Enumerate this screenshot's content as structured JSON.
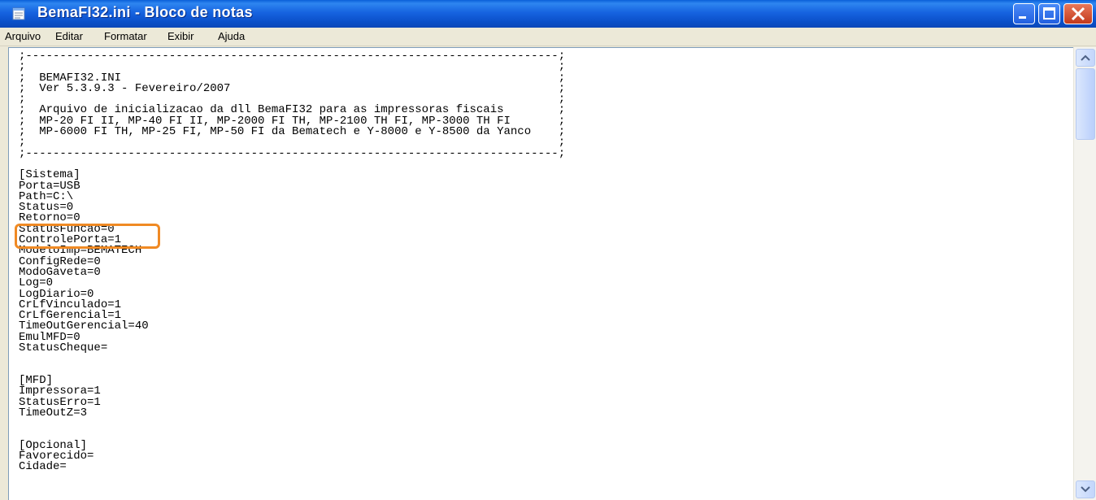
{
  "window": {
    "title": "BemaFI32.ini - Bloco de notas",
    "titlebar_color": "#0a4fc8"
  },
  "icons": {
    "app": "notepad-icon",
    "minimize": "minimize-icon",
    "maximize": "maximize-icon",
    "close": "close-icon",
    "scroll_up": "chevron-up-icon",
    "scroll_down": "chevron-down-icon"
  },
  "menu": [
    {
      "label": "Arquivo",
      "mnemonic": "A"
    },
    {
      "label": "Editar",
      "mnemonic": "E"
    },
    {
      "label": "Formatar",
      "mnemonic": "F"
    },
    {
      "label": "Exibir",
      "mnemonic": "x"
    },
    {
      "label": "Ajuda",
      "mnemonic": "u"
    }
  ],
  "document": {
    "lines": [
      ";------------------------------------------------------------------------------;",
      ";                                                                              ;",
      ";  BEMAFI32.INI                                                                ;",
      ";  Ver 5.3.9.3 - Fevereiro/2007                                                ;",
      ";                                                                              ;",
      ";  Arquivo de inicializacao da dll BemaFI32 para as impressoras fiscais        ;",
      ";  MP-20 FI II, MP-40 FI II, MP-2000 FI TH, MP-2100 TH FI, MP-3000 TH FI       ;",
      ";  MP-6000 FI TH, MP-25 FI, MP-50 FI da Bematech e Y-8000 e Y-8500 da Yanco    ;",
      ";                                                                              ;",
      ";------------------------------------------------------------------------------;",
      "",
      "[Sistema]",
      "Porta=USB",
      "Path=C:\\",
      "Status=0",
      "Retorno=0",
      "StatusFuncao=0",
      "ControlePorta=1",
      "ModeloImp=BEMATECH",
      "ConfigRede=0",
      "ModoGaveta=0",
      "Log=0",
      "LogDiario=0",
      "CrLfVinculado=1",
      "CrLfGerencial=1",
      "TimeOutGerencial=40",
      "EmulMFD=0",
      "StatusCheque=",
      "",
      "",
      "[MFD]",
      "Impressora=1",
      "StatusErro=1",
      "TimeOutZ=3",
      "",
      "",
      "[Opcional]",
      "Favorecido=",
      "Cidade="
    ]
  },
  "annotation": {
    "highlighted_line": "Porta=USB",
    "color": "#f08a24"
  }
}
